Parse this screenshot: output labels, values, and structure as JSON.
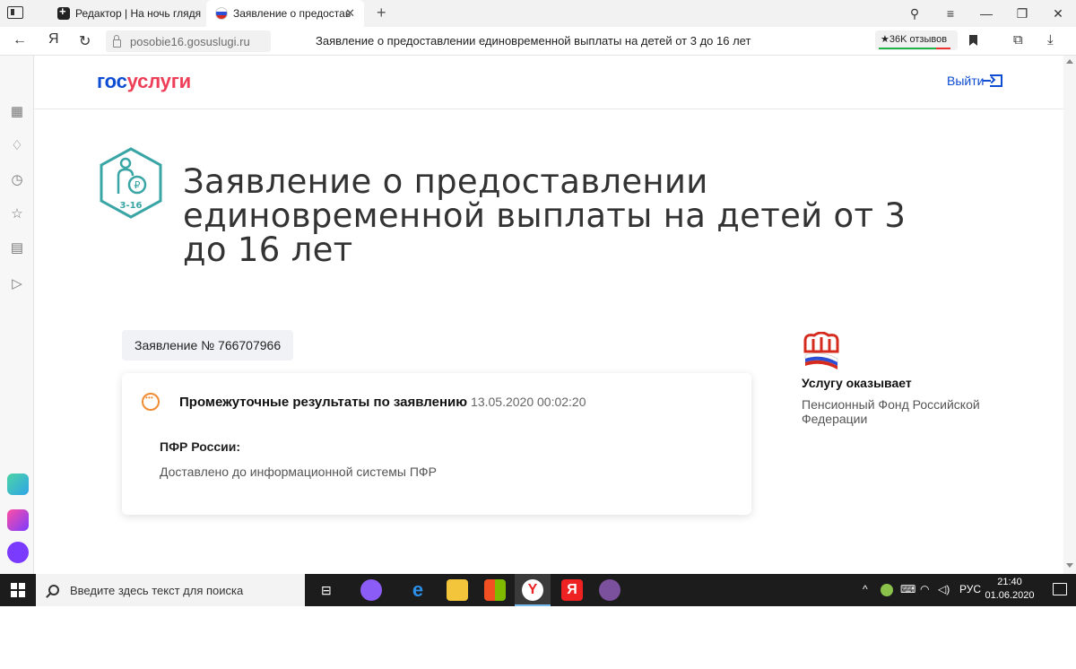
{
  "browser": {
    "tabs": [
      {
        "label": "Редактор | На ночь глядя",
        "icon": "editor-icon"
      },
      {
        "label": "Заявление о предостав",
        "icon": "russia-flag-icon",
        "active": true
      }
    ],
    "address": {
      "ya_logo": "Я",
      "domain": "posobie16.gosuslugi.ru",
      "page_title": "Заявление о предоставлении единовременной выплаты на детей от 3 до 16 лет",
      "reviews": "★36K отзывов"
    }
  },
  "site": {
    "logo_part1": "гос",
    "logo_part2": "услуги",
    "logout_label": "Выйти",
    "service_icon_text": "3-16",
    "service_title": "Заявление о предоставлении единовременной выплаты на детей от 3 до 16 лет",
    "application_number": "Заявление № 766707966",
    "card": {
      "title": "Промежуточные результаты по заявлению",
      "date": "13.05.2020 00:02:20",
      "org": "ПФР России:",
      "status": "Доставлено до информационной системы ПФР"
    },
    "provider": {
      "label": "Услугу оказывает",
      "name": "Пенсионный Фонд Российской Федерации"
    }
  },
  "taskbar": {
    "search_placeholder": "Введите здесь текст для поиска",
    "language": "РУС",
    "time": "21:40",
    "date": "01.06.2020"
  },
  "colors": {
    "brand_blue": "#0d4cd3",
    "brand_red": "#ee3f58",
    "status_orange": "#f28b31",
    "icon_teal": "#39a5a5"
  }
}
